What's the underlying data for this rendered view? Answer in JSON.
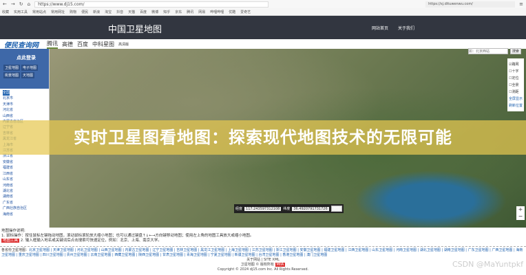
{
  "browser": {
    "url": "https://www.dj15.com/",
    "url2": "https://sj.dituwenwu.com/",
    "bookmarks": [
      "收藏",
      "实用工具",
      "常用站点",
      "常用网址",
      "购物",
      "便民",
      "新浪",
      "淘宝",
      "抖音",
      "天猫",
      "百度",
      "微博",
      "知乎",
      "京东",
      "腾讯",
      "网易",
      "哔哩哔哩",
      "优酷",
      "爱奇艺"
    ]
  },
  "header": {
    "title": "中国卫星地图",
    "links": [
      "网站首页",
      "关于我们"
    ]
  },
  "subnav": {
    "logo": "便民查询网",
    "tabs": [
      "腾讯",
      "高德",
      "百度",
      "中科星图"
    ],
    "extra": "高清版"
  },
  "sidebar": {
    "login": "点此登录",
    "buttons": [
      "卫星地图",
      "电子地图",
      "街景地图",
      "天地图"
    ],
    "tree": [
      "全国",
      "北京市",
      "天津市",
      "河北省",
      "山西省",
      "内蒙古自治区",
      "辽宁省",
      "吉林省",
      "黑龙江省",
      "上海市",
      "江苏省",
      "浙江省",
      "安徽省",
      "福建省",
      "江西省",
      "山东省",
      "河南省",
      "湖北省",
      "湖南省",
      "广东省",
      "广西壮族自治区",
      "海南省"
    ]
  },
  "overlay_title": "实时卫星图看地图：探索现代地图技术的无限可能",
  "search": {
    "placeholder": "如：北京西站",
    "button": "搜索"
  },
  "options": {
    "items": [
      "路网",
      "十字",
      "定位",
      "全景",
      "测距"
    ],
    "fullscreen": "全屏显示",
    "refresh": "刷新位置"
  },
  "coords": {
    "lng_label": "经度",
    "lng": "117.243597312108",
    "lat_label": "纬度",
    "lat": "36.4920791731726",
    "button": "定位"
  },
  "info": {
    "title": "地图操作说明:",
    "line1": "1. 鼠标操作：按住鼠标左键拖动地图，滚动鼠标滚轮放大缩小地图；也可以通过键盘↑↓←→方向键移动地图；使用左上角的地图工具放大或缩小地图。",
    "line2": "2. 输入框输入地名或关键词后点击搜索可快速定位，例如：北京、上海、南京大学。",
    "tool": "地图工具"
  },
  "footer": {
    "label": "各省份卫星地图：",
    "links": "北京卫星地图 | 天津卫星地图 | 河北卫星地图 | 山西卫星地图 | 内蒙古卫星地图 | 辽宁卫星地图 | 吉林卫星地图 | 黑龙江卫星地图 | 上海卫星地图 | 江苏卫星地图 | 浙江卫星地图 | 安徽卫星地图 | 福建卫星地图 | 江西卫星地图 | 山东卫星地图 | 河南卫星地图 | 湖北卫星地图 | 湖南卫星地图 | 广东卫星地图 | 广西卫星地图 | 海南卫星地图 | 重庆卫星地图 | 四川卫星地图 | 贵州卫星地图 | 云南卫星地图 | 西藏卫星地图 | 陕西卫星地图 | 甘肃卫星地图 | 青海卫星地图 | 宁夏卫星地图 | 新疆卫星地图 | 台湾卫星地图 | 香港卫星地图 | 澳门卫星地图",
    "about": "关于网站 | SITE XML",
    "brand": "卫星地图 © 版权所有",
    "badge": "MIIA",
    "copyright": "Copyright © 2024 dj15.com Inc. All Rights Reserved."
  },
  "watermark": "CSDN @MaYuntpkf"
}
